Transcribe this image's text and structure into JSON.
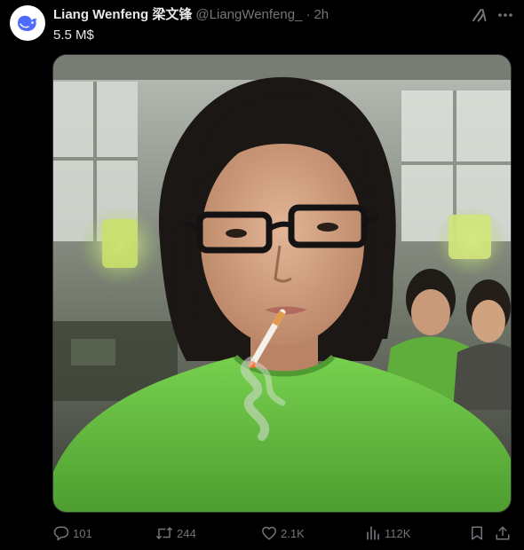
{
  "post": {
    "author_name": "Liang Wenfeng 梁文锋",
    "handle": "@LiangWenfeng_",
    "separator": "·",
    "time": "2h",
    "text": "5.5 M$"
  },
  "media": {
    "icon": "photo"
  },
  "actions": {
    "replies": "101",
    "reposts": "244",
    "likes": "2.1K",
    "views": "112K"
  },
  "icons": {
    "avatar": "whale-logo-icon",
    "grok": "grok-icon",
    "more": "more-icon",
    "reply": "reply-icon",
    "repost": "repost-icon",
    "like": "heart-icon",
    "views": "views-icon",
    "bookmark": "bookmark-icon",
    "share": "share-icon"
  },
  "colors": {
    "background": "#000000",
    "text": "#e7e9ea",
    "muted": "#71767b",
    "avatar_blue": "#4d6bfe",
    "shirt_green": "#6cc94a"
  }
}
